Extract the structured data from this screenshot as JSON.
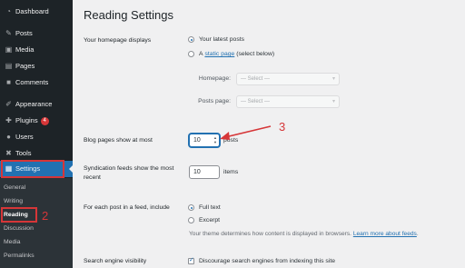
{
  "sidebar": {
    "items": [
      {
        "label": "Dashboard",
        "icon": "dashboard-icon",
        "glyph": "◔"
      },
      {
        "label": "Posts",
        "icon": "pin-icon",
        "glyph": "✎"
      },
      {
        "label": "Media",
        "icon": "media-icon",
        "glyph": "▣"
      },
      {
        "label": "Pages",
        "icon": "pages-icon",
        "glyph": "▤"
      },
      {
        "label": "Comments",
        "icon": "comments-icon",
        "glyph": "■"
      },
      {
        "label": "Appearance",
        "icon": "brush-icon",
        "glyph": "✐"
      },
      {
        "label": "Plugins",
        "icon": "plug-icon",
        "glyph": "✚",
        "badge": "4"
      },
      {
        "label": "Users",
        "icon": "user-icon",
        "glyph": "●"
      },
      {
        "label": "Tools",
        "icon": "wrench-icon",
        "glyph": "✖"
      },
      {
        "label": "Settings",
        "icon": "settings-icon",
        "glyph": "▦"
      }
    ],
    "submenu": [
      "General",
      "Writing",
      "Reading",
      "Discussion",
      "Media",
      "Permalinks"
    ],
    "current_submenu": "Reading"
  },
  "annotations": {
    "n1": "2",
    "n2": "3"
  },
  "page": {
    "title": "Reading Settings"
  },
  "homepage": {
    "label": "Your homepage displays",
    "option_latest": "Your latest posts",
    "option_static_prefix": "A",
    "option_static_link": "static page",
    "option_static_suffix": "(select below)",
    "homepage_label": "Homepage:",
    "homepage_value": "— Select —",
    "posts_label": "Posts page:",
    "posts_value": "— Select —"
  },
  "blog_pages": {
    "label": "Blog pages show at most",
    "value": "10",
    "suffix": "posts"
  },
  "syndication": {
    "label": "Syndication feeds show the most recent",
    "value": "10",
    "suffix": "items"
  },
  "feed": {
    "label": "For each post in a feed, include",
    "full": "Full text",
    "excerpt": "Excerpt",
    "desc_prefix": "Your theme determines how content is displayed in browsers.",
    "desc_link": "Learn more about feeds",
    "desc_suffix": "."
  },
  "visibility": {
    "label": "Search engine visibility",
    "checkbox": "Discourage search engines from indexing this site"
  },
  "colors": {
    "sidebar": "#1d2327",
    "accent": "#2271b1",
    "annotation": "#d63638"
  }
}
